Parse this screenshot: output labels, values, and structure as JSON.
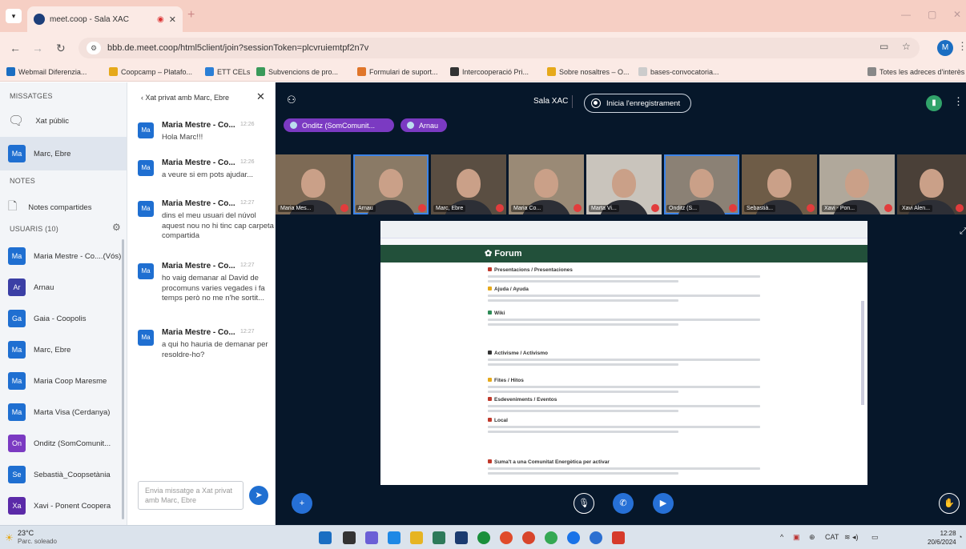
{
  "browser": {
    "tab_title": "meet.coop - Sala XAC",
    "url": "bbb.de.meet.coop/html5client/join?sessionToken=plcvruiemtpf2n7v",
    "bookmarks": [
      "Webmail Diferenzia...",
      "Coopcamp – Platafo...",
      "ETT CELs",
      "Subvencions de pro...",
      "Formulari de suport...",
      "Intercooperació Pri...",
      "Sobre nosaltres – O...",
      "bases-convocatoria...",
      "Totes les adreces d'interès"
    ],
    "profile_initial": "M"
  },
  "sidebar": {
    "messages_title": "MISSATGES",
    "public_chat": "Xat públic",
    "private_chat": {
      "avatar": "Ma",
      "label": "Marc, Ebre"
    },
    "notes_title": "NOTES",
    "shared_notes": "Notes compartides",
    "users_title": "USUARIS (10)",
    "users": [
      {
        "avatar": "Ma",
        "name": "Maria Mestre - Co....(Vós)",
        "color": "#1f6fd1",
        "status": "red"
      },
      {
        "avatar": "Ar",
        "name": "Arnau",
        "color": "#3b3fa5",
        "status": "green"
      },
      {
        "avatar": "Ga",
        "name": "Gaia - Coopolis",
        "color": "#1f6fd1",
        "status": "red"
      },
      {
        "avatar": "Ma",
        "name": "Marc, Ebre",
        "color": "#1f6fd1",
        "status": "red"
      },
      {
        "avatar": "Ma",
        "name": "Maria Coop Maresme",
        "color": "#1f6fd1",
        "status": "red"
      },
      {
        "avatar": "Ma",
        "name": "Marta Visa (Cerdanya)",
        "color": "#1f6fd1",
        "status": "red"
      },
      {
        "avatar": "On",
        "name": "Onditz (SomComunit...",
        "color": "#7b3ac2",
        "status": "green"
      },
      {
        "avatar": "Se",
        "name": "Sebastià_Coopsetània",
        "color": "#1f6fd1",
        "status": "red"
      },
      {
        "avatar": "Xa",
        "name": "Xavi - Ponent Coopera",
        "color": "#5b2aa8",
        "status": "red"
      }
    ]
  },
  "chat": {
    "header": "Xat privat amb Marc, Ebre",
    "messages": [
      {
        "avatar": "Ma",
        "name": "Maria Mestre - Co...",
        "time": "12:26",
        "text": "Hola Marc!!!"
      },
      {
        "avatar": "Ma",
        "name": "Maria Mestre - Co...",
        "time": "12:26",
        "text": "a veure si em pots ajudar..."
      },
      {
        "avatar": "Ma",
        "name": "Maria Mestre - Co...",
        "time": "12:27",
        "text": "dins el meu usuari del núvol aquest nou no hi tinc cap carpeta compartida"
      },
      {
        "avatar": "Ma",
        "name": "Maria Mestre - Co...",
        "time": "12:27",
        "text": "ho vaig demanar al David de procomuns varies vegades i fa temps però no me n'he sortit..."
      },
      {
        "avatar": "Ma",
        "name": "Maria Mestre - Co...",
        "time": "12:27",
        "text": "a qui ho hauria de demanar per resoldre-ho?"
      }
    ],
    "input_placeholder": "Envia missatge a Xat privat amb Marc, Ebre"
  },
  "meeting": {
    "room_name": "Sala XAC",
    "record_label": "Inicia l'enregistrament",
    "talking": [
      "Onditz (SomComunit...",
      "Arnau"
    ],
    "videos": [
      {
        "label": "Maria Mes...",
        "bg": "#7d6a55",
        "highlight": false
      },
      {
        "label": "Arnau",
        "bg": "#8a7a66",
        "highlight": true
      },
      {
        "label": "Marc, Ebre",
        "bg": "#5a4e42",
        "highlight": false
      },
      {
        "label": "Maria Co...",
        "bg": "#9a8a76",
        "highlight": false
      },
      {
        "label": "Marta Vi...",
        "bg": "#c9c4bc",
        "highlight": false
      },
      {
        "label": "Onditz (S...",
        "bg": "#8b8175",
        "highlight": true
      },
      {
        "label": "Sebastià...",
        "bg": "#6e5c47",
        "highlight": false
      },
      {
        "label": "Xavi - Pon...",
        "bg": "#b0a89b",
        "highlight": false
      },
      {
        "label": "Xavi Alen...",
        "bg": "#4a4038",
        "highlight": false
      }
    ]
  },
  "screenshare": {
    "forum_title": "Forum",
    "categories": [
      {
        "title": "Presentacions / Presentaciones",
        "dot": "#c0392b"
      },
      {
        "title": "Ajuda / Ayuda",
        "dot": "#e6a91a"
      },
      {
        "title": "Wiki",
        "dot": "#2e8b57"
      },
      {
        "title": "Activisme / Activismo",
        "dot": "#333333"
      },
      {
        "title": "Fites / Hitos",
        "dot": "#e6a91a"
      },
      {
        "title": "Esdeveniments / Eventos",
        "dot": "#c0392b"
      },
      {
        "title": "Local",
        "dot": "#c0392b"
      },
      {
        "title": "Suma't a una Comunitat Energètica per activar",
        "dot": "#c0392b"
      }
    ]
  },
  "taskbar": {
    "temperature": "23°C",
    "weather": "Parc. soleado",
    "lang": "CAT",
    "time": "12:28",
    "date": "20/6/2024"
  }
}
